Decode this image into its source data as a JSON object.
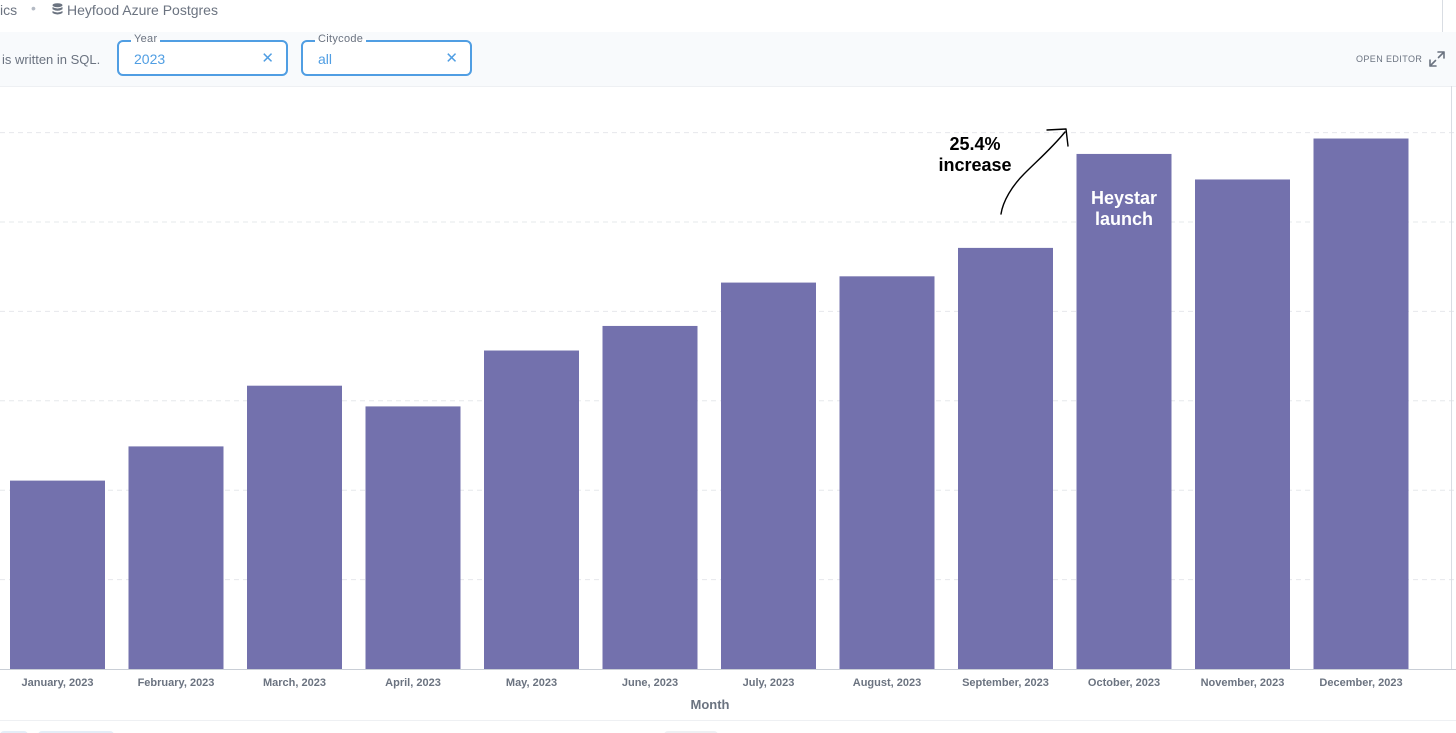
{
  "breadcrumb": {
    "collection": "ics",
    "database": "Heyfood Azure Postgres"
  },
  "query": {
    "note": "is written in SQL."
  },
  "filters": [
    {
      "label": "Year",
      "value": "2023"
    },
    {
      "label": "Citycode",
      "value": "all"
    }
  ],
  "toolbar": {
    "open_editor_label": "OPEN EDITOR"
  },
  "icons": {
    "database": "database-icon",
    "clear": "close-icon",
    "expand": "expand-icon"
  },
  "colors": {
    "bar": "#7371ad",
    "accent": "#509ee3",
    "text_muted": "#6b7380",
    "grid": "#e6e8eb"
  },
  "chart_data": {
    "type": "bar",
    "categories": [
      "January, 2023",
      "February, 2023",
      "March, 2023",
      "April, 2023",
      "May, 2023",
      "June, 2023",
      "July, 2023",
      "August, 2023",
      "September, 2023",
      "October, 2023",
      "November, 2023",
      "December, 2023"
    ],
    "values": [
      39.1,
      46.2,
      58.8,
      54.5,
      66.1,
      71.2,
      80.2,
      81.5,
      87.4,
      106.9,
      101.6,
      110.1
    ],
    "ylim": [
      0,
      121
    ],
    "xlabel": "Month",
    "ylabel": "",
    "grid": true,
    "annotations": [
      {
        "text_line1": "25.4%",
        "text_line2": "increase",
        "category": "September, 2023"
      },
      {
        "text_line1": "Heystar",
        "text_line2": "launch",
        "category": "October, 2023"
      }
    ]
  }
}
